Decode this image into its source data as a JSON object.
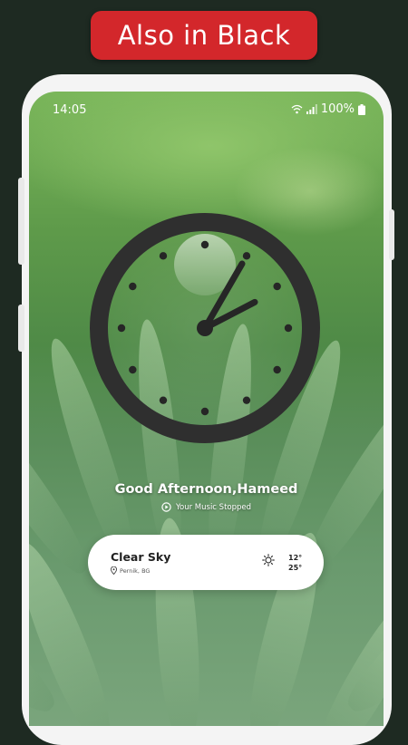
{
  "banner": {
    "label": "Also in Black"
  },
  "status_bar": {
    "time": "14:05",
    "battery": "100%"
  },
  "clock": {
    "hour": 2,
    "minute": 5,
    "hour_markers": 12
  },
  "greeting": {
    "text": "Good Afternoon,Hameed"
  },
  "music": {
    "status": "Your Music Stopped",
    "icon": "play-circle-icon"
  },
  "weather": {
    "condition": "Clear Sky",
    "location": "Pernik, BG",
    "low_temp": "12°",
    "high_temp": "25°",
    "icon": "sun-icon"
  },
  "colors": {
    "banner": "#d3272b",
    "clock_ring": "#2f2f2f",
    "clock_hands": "#262626",
    "card": "#ffffff"
  }
}
